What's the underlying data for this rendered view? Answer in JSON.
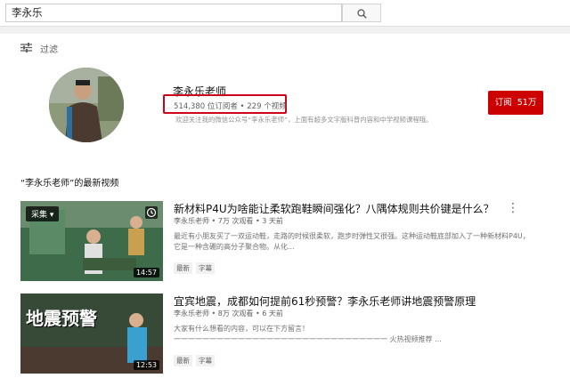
{
  "search": {
    "query": "李永乐"
  },
  "filter": {
    "label": "过滤"
  },
  "channel": {
    "name": "李永乐老师",
    "stats": "514,380 位订阅者 • 229 个视频",
    "description": "欢迎关注我的微信公众号“李永乐老师”，上面有超多文字版科普内容和中学视频课程哦。",
    "subscribe_label": "订阅",
    "subscriber_count": "51万"
  },
  "section": {
    "title": "“李永乐老师”的最新视频"
  },
  "videos": [
    {
      "title": "新材料P4U为啥能让柔软跑鞋瞬间强化？八隅体规则共价键是什么？",
      "meta": "李永乐老师 • 7万 次观看 • 3 天前",
      "desc": "最近有小朋友买了一双运动鞋，走路的时候很柔软，跑步时弹性又很强。这种运动鞋底部加入了一种新材料P4U，它是一种含硼的高分子聚合物。从化...",
      "badges": [
        "最新",
        "字幕"
      ],
      "duration": "14:57",
      "thumb_chip": "采集"
    },
    {
      "title": "宜宾地震，成都如何提前61秒预警？李永乐老师讲地震预警原理",
      "meta": "李永乐老师 • 8万 次观看 • 6 天前",
      "desc": "大家有什么想看的内容，可以在下方留言！",
      "desc2": "一一一一一一一一一一一一一一一一一一一一一一一一一一一一一一 火热视频推荐 ...",
      "badges": [
        "最新",
        "字幕"
      ],
      "duration": "12:53",
      "thumb_text": "地震预警"
    }
  ]
}
